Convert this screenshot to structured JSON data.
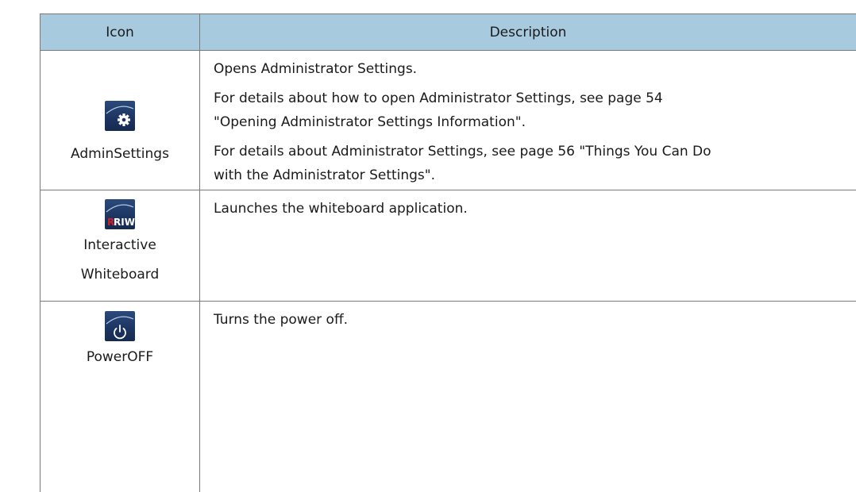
{
  "header": {
    "icon_col": "Icon",
    "description_col": "Description"
  },
  "rows": [
    {
      "icon": "gear-icon",
      "icon_name_lines": [
        "AdminSettings"
      ],
      "description": [
        "Opens Administrator Settings.",
        "For details about how to open Administrator Settings, see page 54",
        "\"Opening Administrator Settings Information\".",
        "For details about Administrator Settings, see page 56 \"Things You Can Do",
        "with the Administrator Settings\"."
      ]
    },
    {
      "icon": "riwb-logo-icon",
      "icon_text": "RIWB",
      "icon_name_lines": [
        "Interactive",
        "Whiteboard"
      ],
      "description": [
        "Launches the whiteboard application."
      ]
    },
    {
      "icon": "power-icon",
      "icon_name_lines": [
        "PowerOFF"
      ],
      "description": [
        "Turns the power off."
      ]
    }
  ],
  "colors": {
    "header_background": "#a8cadf",
    "border": "#7a7a7a",
    "icon_background": "#1c3460",
    "riwb_red": "#d0202a"
  }
}
